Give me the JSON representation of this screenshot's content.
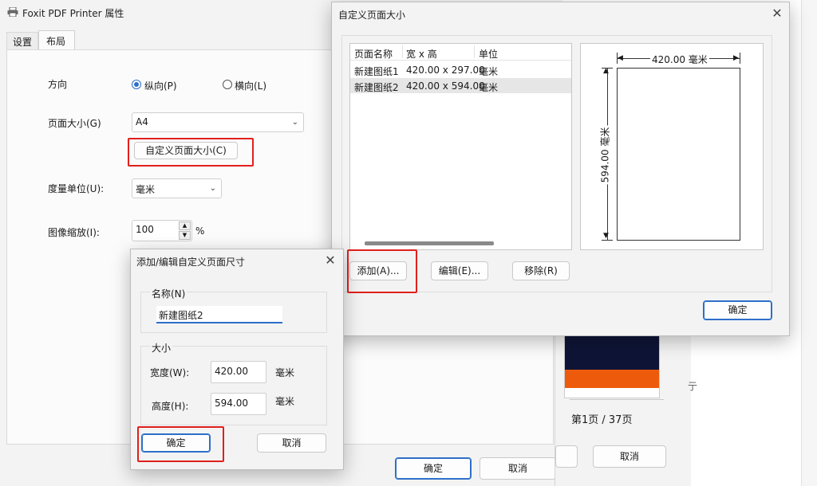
{
  "printer_window": {
    "title": "Foxit PDF Printer 属性",
    "tabs": [
      "设置",
      "布局"
    ],
    "orientation_label": "方向",
    "orientation_portrait": "纵向(P)",
    "orientation_landscape": "横向(L)",
    "page_size_label": "页面大小(G)",
    "page_size_value": "A4",
    "custom_size_button": "自定义页面大小(C)",
    "unit_label": "度量单位(U):",
    "unit_value": "毫米",
    "scale_label": "图像缩放(I):",
    "scale_value": "100",
    "scale_unit": "%",
    "ok_button": "确定",
    "cancel_button": "取消"
  },
  "preview_window": {
    "page_indicator": "第1页 / 37页",
    "cancel_button": "取消",
    "side_text": "亍"
  },
  "custom_dialog": {
    "title": "自定义页面大小",
    "table_headers": [
      "页面名称",
      "宽 x 高",
      "单位"
    ],
    "rows": [
      {
        "name": "新建图纸1",
        "size": "420.00 x 297.00",
        "unit": "毫米"
      },
      {
        "name": "新建图纸2",
        "size": "420.00 x 594.00",
        "unit": "毫米"
      }
    ],
    "width_dimension": "420.00 毫米",
    "height_dimension": "594.00 毫米",
    "add_button": "添加(A)...",
    "edit_button": "编辑(E)...",
    "remove_button": "移除(R)",
    "ok_button": "确定"
  },
  "edit_dialog": {
    "title": "添加/编辑自定义页面尺寸",
    "name_group": "名称(N)",
    "name_value": "新建图纸2",
    "size_group": "大小",
    "width_label": "宽度(W):",
    "width_value": "420.00",
    "width_unit": "毫米",
    "height_label": "高度(H):",
    "height_value": "594.00",
    "height_unit": "毫米",
    "ok_button": "确定",
    "cancel_button": "取消"
  },
  "colors": {
    "highlight_red": "#e0201c",
    "accent_blue": "#2d6fc9",
    "preview_navy": "#0e1436",
    "preview_orange": "#ee5a0c"
  }
}
